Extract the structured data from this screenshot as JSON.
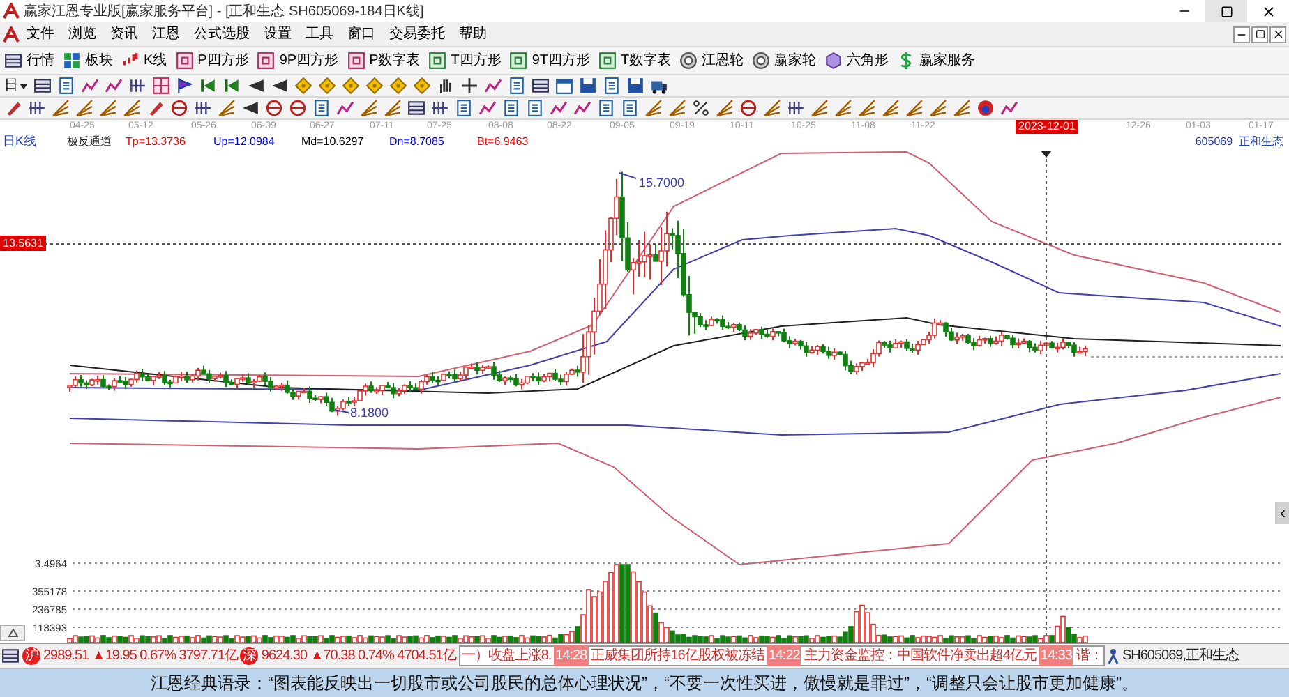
{
  "window": {
    "title": "赢家江恩专业版[赢家服务平台] - [正和生态  SH605069-184日K线]"
  },
  "menu": [
    "文件",
    "浏览",
    "资讯",
    "江恩",
    "公式选股",
    "设置",
    "工具",
    "窗口",
    "交易委托",
    "帮助"
  ],
  "toolbar": [
    {
      "label": "行情"
    },
    {
      "label": "板块"
    },
    {
      "label": "K线"
    },
    {
      "label": "P四方形"
    },
    {
      "label": "9P四方形"
    },
    {
      "label": "P数字表"
    },
    {
      "label": "T四方形"
    },
    {
      "label": "9T四方形"
    },
    {
      "label": "T数字表"
    },
    {
      "label": "江恩轮"
    },
    {
      "label": "赢家轮"
    },
    {
      "label": "六角形"
    },
    {
      "label": "赢家服务"
    }
  ],
  "period_selector": {
    "label": "日"
  },
  "date_axis": [
    {
      "label": "04-25",
      "selected": false
    },
    {
      "label": "05-12",
      "selected": false
    },
    {
      "label": "05-26",
      "selected": false
    },
    {
      "label": "06-09",
      "selected": false
    },
    {
      "label": "06-27",
      "selected": false
    },
    {
      "label": "07-11",
      "selected": false
    },
    {
      "label": "07-25",
      "selected": false
    },
    {
      "label": "08-08",
      "selected": false
    },
    {
      "label": "08-22",
      "selected": false
    },
    {
      "label": "09-05",
      "selected": false
    },
    {
      "label": "09-19",
      "selected": false
    },
    {
      "label": "10-11",
      "selected": false
    },
    {
      "label": "10-25",
      "selected": false
    },
    {
      "label": "11-08",
      "selected": false
    },
    {
      "label": "11-22",
      "selected": false
    },
    {
      "label": "2023-12-01",
      "selected": true
    },
    {
      "label": "12-26",
      "selected": false
    },
    {
      "label": "01-03",
      "selected": false
    },
    {
      "label": "01-17",
      "selected": false
    }
  ],
  "chart": {
    "period": "日K线",
    "indicator": "极反通道",
    "values": [
      {
        "label": "Tp=13.3736",
        "color": "#ff0000"
      },
      {
        "label": "Up=12.0984",
        "color": "#0000ff"
      },
      {
        "label": "Md=10.6297",
        "color": "#000000"
      },
      {
        "label": "Dn=8.7085",
        "color": "#0000ff"
      },
      {
        "label": "Bt=6.9463",
        "color": "#ff0000"
      }
    ],
    "stock": "605069  正和生态",
    "crosshair_price": "13.5631",
    "high_label": "15.7000",
    "low_label": "8.1800"
  },
  "volume": {
    "axis_labels": [
      "3.4964",
      "355178",
      "236785",
      "118393"
    ]
  },
  "status_bar": {
    "indices": [
      {
        "badge": "沪",
        "quote": "2989.51 ▲19.95 0.67% 3797.71亿"
      },
      {
        "badge": "深",
        "quote": "9624.30 ▲70.38 0.74% 4704.51亿"
      }
    ],
    "news": [
      {
        "text": "一）收盘上涨8."
      },
      {
        "time": "14:28",
        "text": "正威集团所持16亿股权被冻结"
      },
      {
        "time": "14:22",
        "text": "主力资金监控：中国软件净卖出超4亿元"
      },
      {
        "time": "14:33",
        "text": "谐："
      }
    ],
    "stock": "SH605069,正和生态"
  },
  "ticker": "江恩经典语录：“图表能反映出一切股市或公司股民的总体心理状况”，“不要一次性买进，傲慢就是罪过”，“调整只会让股市更加健康”。"
}
